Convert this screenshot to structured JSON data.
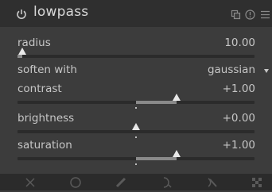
{
  "header": {
    "title": "lowpass",
    "icons": [
      "power-icon",
      "presets-icon",
      "reset-icon",
      "menu-icon"
    ]
  },
  "params": {
    "radius": {
      "label": "radius",
      "value": "10.00",
      "level": 0.02
    },
    "soften_with": {
      "label": "soften with",
      "value": "gaussian"
    },
    "contrast": {
      "label": "contrast",
      "value": "+1.00",
      "level": 0.67
    },
    "brightness": {
      "label": "brightness",
      "value": "+0.00",
      "level": 0.5
    },
    "saturation": {
      "label": "saturation",
      "value": "+1.00",
      "level": 0.67
    }
  },
  "blend_modes": [
    "off-icon",
    "uniform-icon",
    "drawn-mask-icon",
    "parametric-mask-icon",
    "drawn-parametric-mask-icon",
    "raster-mask-icon"
  ],
  "colors": {
    "marker": "#e8e8e8",
    "fill": "#8a8a8a",
    "track": "#2b2b2b",
    "background": "#3c3c3c"
  }
}
